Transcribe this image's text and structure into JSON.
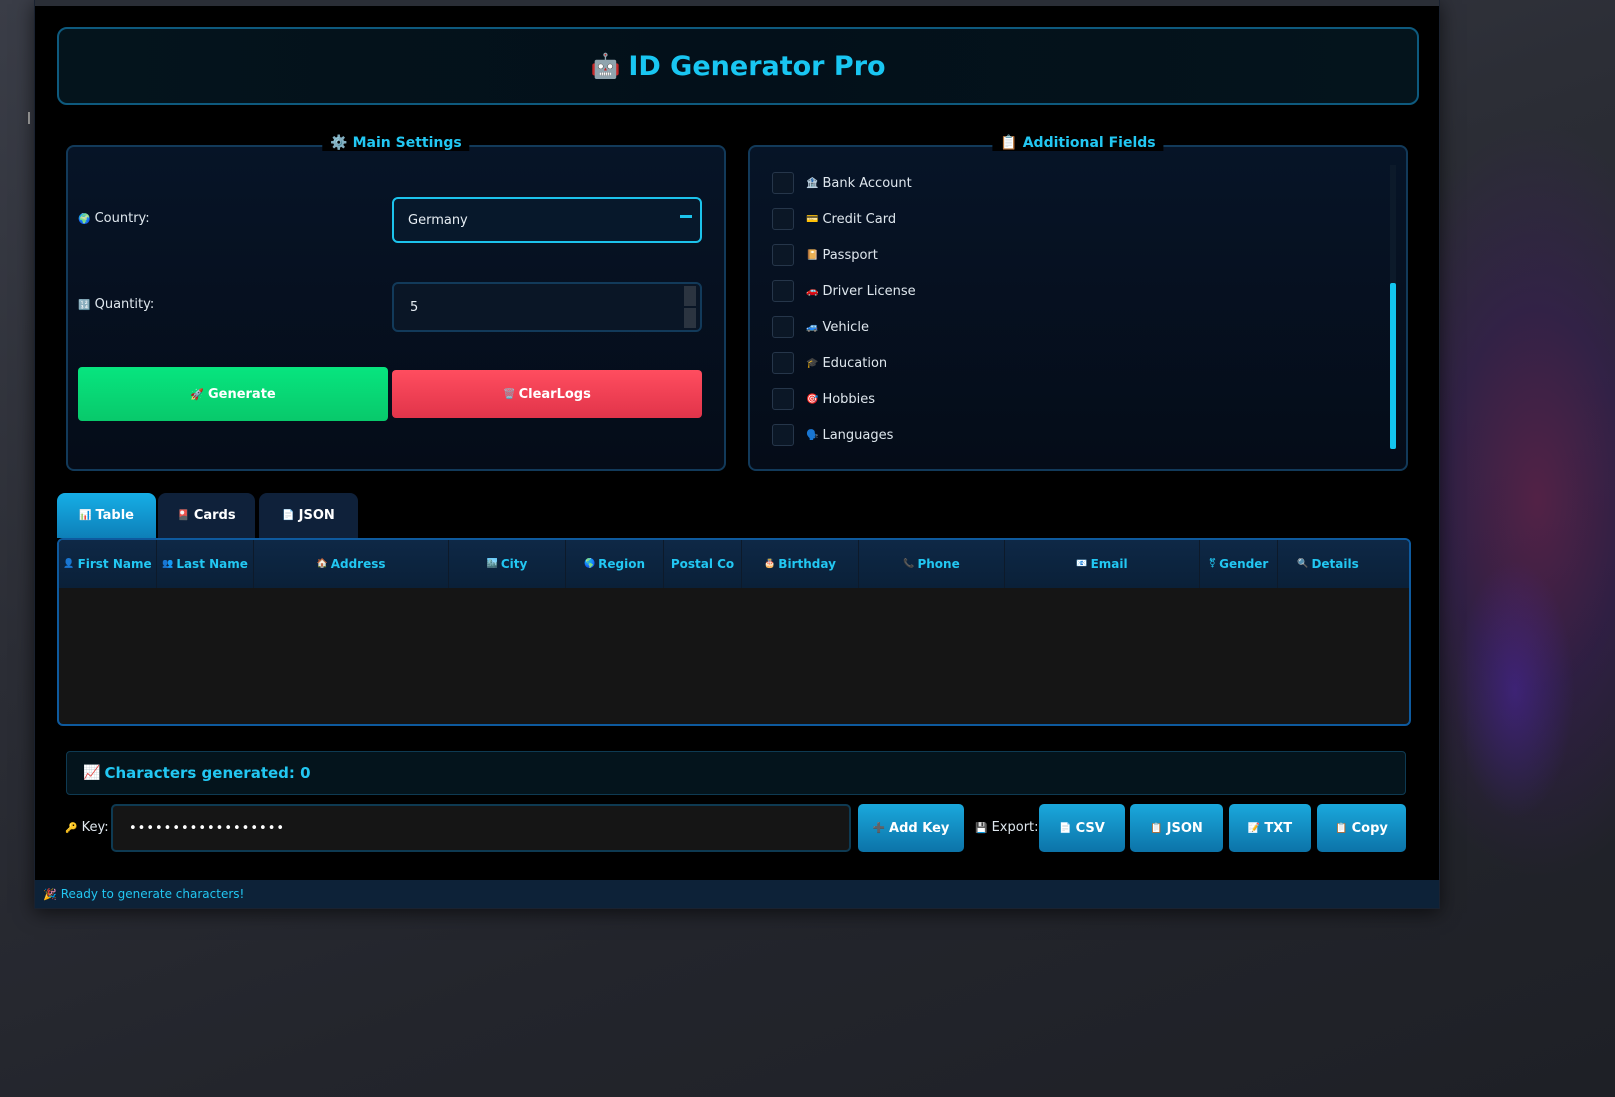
{
  "app": {
    "title": "ID Generator Pro",
    "title_icon": "🤖"
  },
  "main_settings": {
    "title": "Main Settings",
    "title_icon": "⚙️",
    "country_label": "Country:",
    "country_icon": "🌍",
    "country_value": "Germany",
    "quantity_label": "Quantity:",
    "quantity_icon": "🔢",
    "quantity_value": "5",
    "generate_label": "Generate",
    "generate_icon": "🚀",
    "clear_label": "ClearLogs",
    "clear_icon": "🗑️"
  },
  "additional_fields": {
    "title": "Additional Fields",
    "title_icon": "📋",
    "items": [
      {
        "label": "Bank Account",
        "icon": "🏦"
      },
      {
        "label": "Credit Card",
        "icon": "💳"
      },
      {
        "label": "Passport",
        "icon": "📔"
      },
      {
        "label": "Driver License",
        "icon": "🚗"
      },
      {
        "label": "Vehicle",
        "icon": "🚙"
      },
      {
        "label": "Education",
        "icon": "🎓"
      },
      {
        "label": "Hobbies",
        "icon": "🎯"
      },
      {
        "label": "Languages",
        "icon": "🗣️"
      }
    ]
  },
  "tabs": [
    {
      "label": "Table",
      "icon": "📊",
      "active": true
    },
    {
      "label": "Cards",
      "icon": "🎴",
      "active": false
    },
    {
      "label": "JSON",
      "icon": "📄",
      "active": false
    }
  ],
  "table": {
    "columns": [
      {
        "label": "First Name",
        "icon": "👤"
      },
      {
        "label": "Last Name",
        "icon": "👥"
      },
      {
        "label": "Address",
        "icon": "🏠"
      },
      {
        "label": "City",
        "icon": "🏙️"
      },
      {
        "label": "Region",
        "icon": "🌎"
      },
      {
        "label": "Postal Co",
        "icon": ""
      },
      {
        "label": "Birthday",
        "icon": "🎂"
      },
      {
        "label": "Phone",
        "icon": "📞"
      },
      {
        "label": "Email",
        "icon": "📧"
      },
      {
        "label": "Gender",
        "icon": "⚧"
      },
      {
        "label": "Details",
        "icon": "🔍"
      }
    ],
    "rows": []
  },
  "stats": {
    "text": "Characters generated: 0",
    "icon": "📈"
  },
  "key": {
    "label": "Key:",
    "icon": "🔑",
    "value": "••••••••••••••••••",
    "add_label": "Add Key",
    "add_icon": "➕"
  },
  "export": {
    "label": "Export:",
    "icon": "💾",
    "buttons": [
      {
        "label": "CSV",
        "icon": "📄"
      },
      {
        "label": "JSON",
        "icon": "📋"
      },
      {
        "label": "TXT",
        "icon": "📝"
      },
      {
        "label": "Copy",
        "icon": "📋"
      }
    ]
  },
  "status": {
    "text": "Ready to generate characters!",
    "icon": "🎉"
  },
  "colors": {
    "accent": "#22c7f2",
    "generate": "#08d672",
    "clear": "#f03d52",
    "button_blue": "#128fc6"
  }
}
